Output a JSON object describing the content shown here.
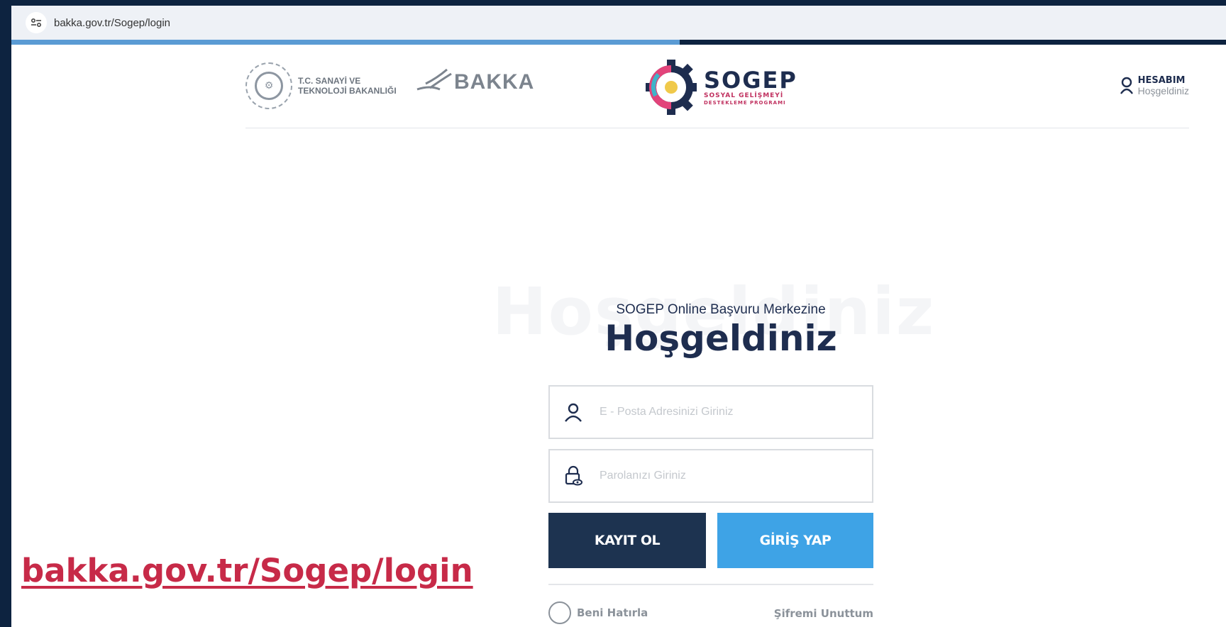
{
  "browser": {
    "url": "bakka.gov.tr/Sogep/login",
    "site_info_icon": "tune-icon",
    "load_progress_fraction": 0.55
  },
  "header": {
    "ministry_line1": "T.C. SANAYİ VE",
    "ministry_line2": "TEKNOLOJİ BAKANLIĞI",
    "agency_name": "BAKKA",
    "program_name": "SOGEP",
    "program_line1": "SOSYAL GELİŞMEYİ",
    "program_line2": "DESTEKLEME PROGRAMI",
    "account_title": "HESABIM",
    "account_sub": "Hoşgeldiniz"
  },
  "login": {
    "background_word": "Hoşgeldiniz",
    "subtitle": "SOGEP Online Başvuru Merkezine",
    "title": "Hoşgeldiniz",
    "email_placeholder": "E - Posta Adresinizi Giriniz",
    "email_value": "",
    "password_placeholder": "Parolanızı Giriniz",
    "password_value": "",
    "register_label": "KAYIT OL",
    "login_label": "GİRİŞ YAP",
    "remember_label": "Beni Hatırla",
    "forgot_label": "Şifremi Unuttum"
  },
  "caption": {
    "text": "bakka.gov.tr/Sogep/login"
  },
  "colors": {
    "page_border": "#0d2340",
    "navy": "#1d3350",
    "accent_blue": "#3ea3e6",
    "caption_red": "#c72a48",
    "progress_blue": "#5a9bd4"
  }
}
